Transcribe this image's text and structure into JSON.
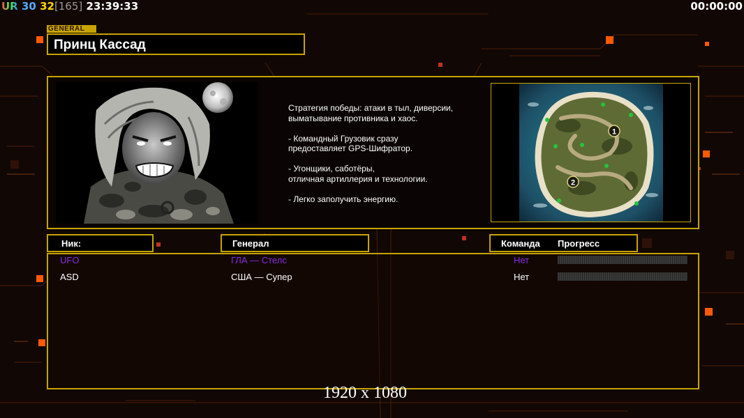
{
  "topbar": {
    "ur_label": "UR",
    "ur_a": "30",
    "ur_b": "32",
    "ping": "[165]",
    "clock": "23:39:33",
    "timer": "00:00:00"
  },
  "general_tag": "GENERAL",
  "general_name": "Принц Кассад",
  "description": "Стратегия победы: атаки в тыл, диверсии,\n выматывание противника и хаос.\n\n- Командный Грузовик сразу\nпредоставляет GPS-Шифратор.\n\n- Угонщики, саботёры,\nотличная артиллерия и технологии.\n\n- Легко заполучить энергию.",
  "map_markers": [
    "1",
    "2"
  ],
  "table_headers": {
    "nick": "Ник:",
    "general": "Генерал",
    "team": "Команда",
    "progress": "Прогресс"
  },
  "players": [
    {
      "nick": "UFO",
      "general": "ГЛА — Стелс",
      "team": "Нет",
      "color": "#8a2be2"
    },
    {
      "nick": "ASD",
      "general": "США — Супер",
      "team": "Нет",
      "color": "#ffffff"
    }
  ],
  "resolution_label": "1920 x 1080",
  "colors": {
    "accent_gold": "#c8a400",
    "background": "#110704",
    "orange_square": "#ff5a00"
  }
}
